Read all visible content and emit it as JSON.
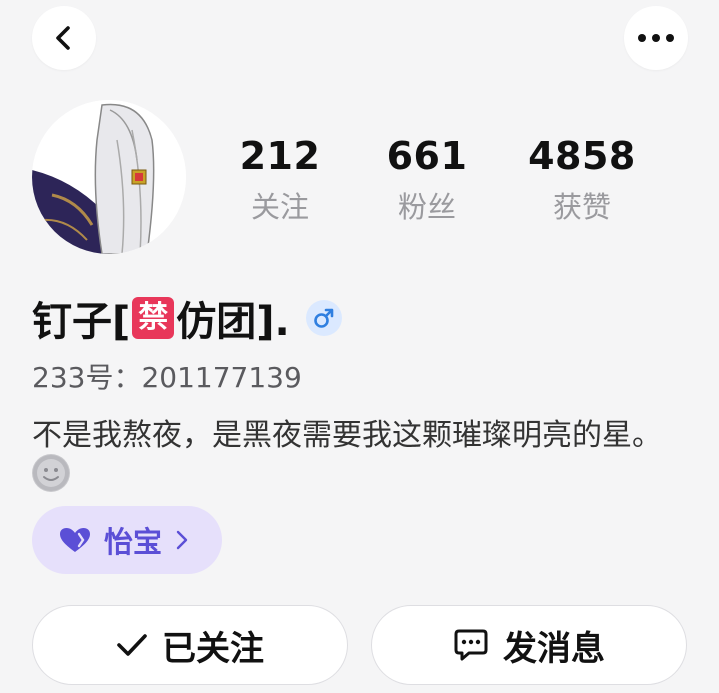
{
  "stats": [
    {
      "value": "212",
      "label": "关注"
    },
    {
      "value": "661",
      "label": "粉丝"
    },
    {
      "value": "4858",
      "label": "获赞"
    }
  ],
  "profile": {
    "name_prefix": "钉子[",
    "name_badge": "禁",
    "name_suffix": "仿团].",
    "gender_symbol": "♂",
    "uid": "233号：201177139",
    "bio": "不是我熬夜，是黑夜需要我这颗璀璨明亮的星。"
  },
  "badge": {
    "label": "怡宝",
    "icon": "heart-icon"
  },
  "actions": {
    "follow_label": "已关注",
    "message_label": "发消息"
  },
  "icons": {
    "back": "back-arrow-icon",
    "more": "more-dots-icon",
    "check": "check-icon",
    "chat": "chat-bubble-icon"
  },
  "colors": {
    "accent": "#5b4fd6",
    "badge_bg": "#e6e0fb",
    "forbid": "#e8375a",
    "gender": "#2f7fe0"
  }
}
